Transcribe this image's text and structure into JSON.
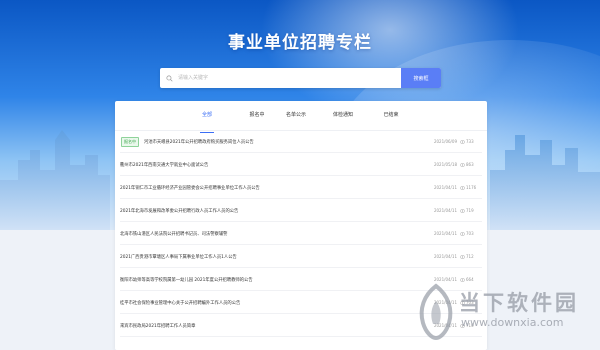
{
  "header": {
    "title": "事业单位招聘专栏"
  },
  "search": {
    "placeholder": "请输入关键字",
    "button_label": "搜索框"
  },
  "tabs": [
    {
      "label": "全部",
      "active": true
    },
    {
      "label": "报名中",
      "active": false
    },
    {
      "label": "名单公示",
      "active": false
    },
    {
      "label": "体检通知",
      "active": false
    },
    {
      "label": "已结束",
      "active": false
    }
  ],
  "list": [
    {
      "badge": "报名中",
      "title": "河池市天峨县2021年公开招聘政府购买服务岗位人员公告",
      "date": "2021/06/09",
      "views": "733"
    },
    {
      "badge": "",
      "title": "衢州市2021年西南交通大学就业中心面试公告",
      "date": "2021/05/18",
      "views": "863"
    },
    {
      "badge": "",
      "title": "2021年铜仁市工业循环经济产业园管委会公开招聘事业单位工作人员公告",
      "date": "2021/04/11",
      "views": "1176"
    },
    {
      "badge": "",
      "title": "2021年北海市发展和改革委公开招聘行政人员工作人员的公告",
      "date": "2021/04/11",
      "views": "719"
    },
    {
      "badge": "",
      "title": "北海市铁山港区人民法院公开招聘书记员、司法警察辅警",
      "date": "2021/04/11",
      "views": "703"
    },
    {
      "badge": "",
      "title": "2021广西贵港市覃塘区人事局下属事业单位工作人员1人公告",
      "date": "2021/04/11",
      "views": "712"
    },
    {
      "badge": "",
      "title": "衡阳市幼师等高等学校院属第一幼儿园 2021年度公开招聘教师的公告",
      "date": "2021/04/11",
      "views": "664"
    },
    {
      "badge": "",
      "title": "桂平市社会保险事业管理中心关于公开招聘编外工作人员的公告",
      "date": "2021/04/11",
      "views": "703"
    },
    {
      "badge": "",
      "title": "来宾市民政局2021年招聘工作人员简章",
      "date": "2021/04/11",
      "views": "710"
    }
  ],
  "watermark": {
    "cn": "当下软件园",
    "en": "www.downxia.com"
  },
  "colors": {
    "accent": "#3b6ef5",
    "badge_green": "#3aa54a",
    "search_button": "#5a7ef6"
  }
}
